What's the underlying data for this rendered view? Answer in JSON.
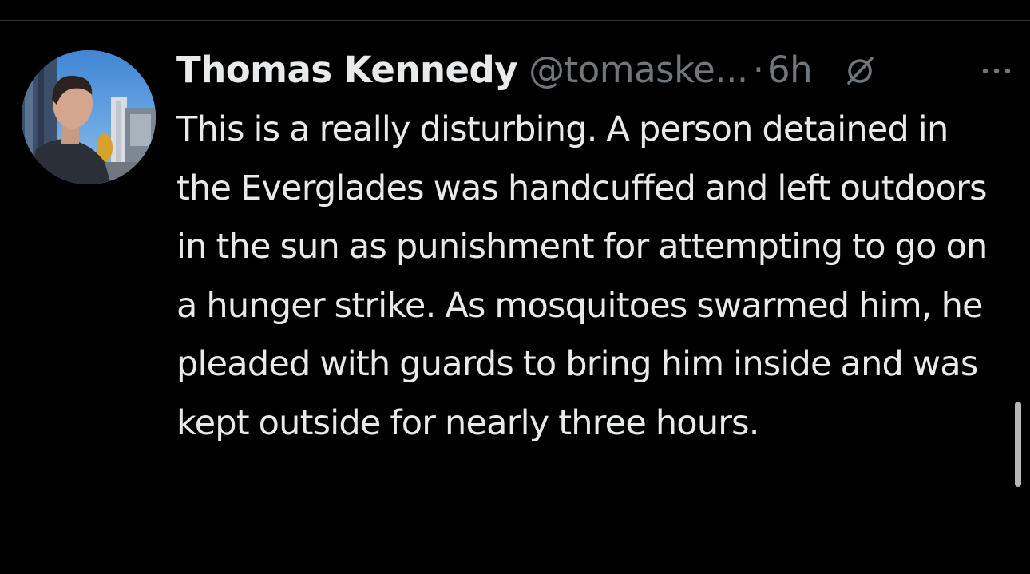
{
  "tweet": {
    "author": {
      "display_name": "Thomas Kennedy",
      "handle": "@tomaske...",
      "avatar": "profile-photo"
    },
    "separator": "·",
    "timestamp": "6h",
    "text": "This is a really disturbing. A person detained in the Everglades was handcuffed and left outdoors in the sun as punishment for attempting to go on a hunger strike. As mosquitoes swarmed him, he pleaded with guards to bring him inside and was kept outside for nearly three hours.",
    "icons": {
      "grok": "grok-icon",
      "more": "more-options-icon"
    }
  },
  "colors": {
    "background": "#000000",
    "primary_text": "#e7e9ea",
    "secondary_text": "#71767b",
    "divider": "#2f3336"
  }
}
